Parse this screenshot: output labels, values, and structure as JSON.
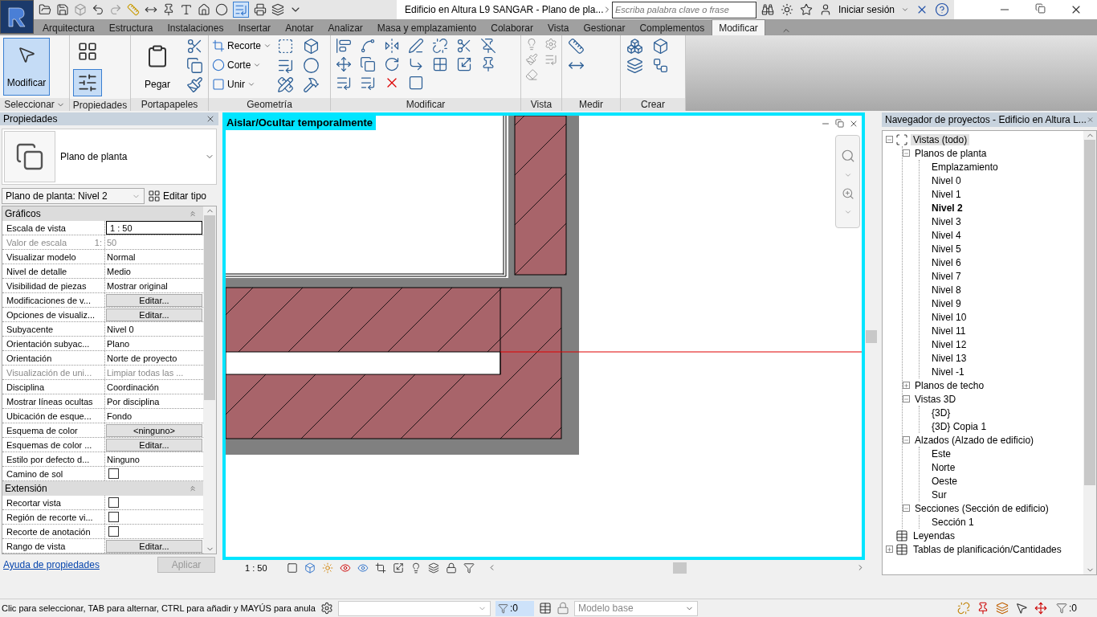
{
  "title_bar": {
    "title": "Edificio en Altura L9 SANGAR - Plano de pla...",
    "search": {
      "placeholder": "Escriba palabra clave o frase"
    },
    "sign_in": "Iniciar sesión"
  },
  "ribbon_tabs": [
    {
      "label": "Arquitectura",
      "selected": false
    },
    {
      "label": "Estructura",
      "selected": false
    },
    {
      "label": "Instalaciones",
      "selected": false
    },
    {
      "label": "Insertar",
      "selected": false
    },
    {
      "label": "Anotar",
      "selected": false
    },
    {
      "label": "Analizar",
      "selected": false
    },
    {
      "label": "Masa y emplazamiento",
      "selected": false
    },
    {
      "label": "Colaborar",
      "selected": false
    },
    {
      "label": "Vista",
      "selected": false
    },
    {
      "label": "Gestionar",
      "selected": false
    },
    {
      "label": "Complementos",
      "selected": false
    },
    {
      "label": "Modificar",
      "selected": true
    }
  ],
  "ribbon_panels": [
    {
      "label": "Seleccionar",
      "has_menu": true,
      "tools": [
        {
          "kind": "large",
          "label": "Modificar",
          "selected": true
        }
      ]
    },
    {
      "label": "Propiedades",
      "has_menu": false,
      "tools": [
        {
          "kind": "icon",
          "selected": false
        },
        {
          "kind": "icon",
          "selected": true
        }
      ]
    },
    {
      "label": "Portapapeles",
      "has_menu": false,
      "tools": [
        {
          "kind": "large",
          "label": "Pegar",
          "selected": false
        }
      ]
    },
    {
      "label": "Geometría",
      "has_menu": false,
      "tools": [
        {
          "kind": "small",
          "label": "Recorte",
          "selected": false
        },
        {
          "kind": "small",
          "label": "Corte",
          "selected": false
        },
        {
          "kind": "small",
          "label": "Unir",
          "selected": false
        }
      ]
    },
    {
      "label": "Modificar",
      "has_menu": false
    },
    {
      "label": "Vista",
      "has_menu": false
    },
    {
      "label": "Medir",
      "has_menu": false
    },
    {
      "label": "Crear",
      "has_menu": false
    }
  ],
  "properties": {
    "title": "Propiedades",
    "type_name": "Plano de planta",
    "instance": "Plano de planta: Nivel 2",
    "edit_type": "Editar tipo",
    "sections": [
      {
        "title": "Gráficos",
        "rows": [
          {
            "kind": "field",
            "label": "Escala de vista",
            "value": "1 : 50",
            "disabled": false
          },
          {
            "kind": "text",
            "label": "Valor de escala",
            "unit": "1:",
            "value": "50",
            "disabled": true
          },
          {
            "kind": "text",
            "label": "Visualizar modelo",
            "value": "Normal",
            "disabled": false
          },
          {
            "kind": "text",
            "label": "Nivel de detalle",
            "value": "Medio",
            "disabled": false
          },
          {
            "kind": "text",
            "label": "Visibilidad de piezas",
            "value": "Mostrar original",
            "disabled": false
          },
          {
            "kind": "button",
            "label": "Modificaciones de v...",
            "value": "Editar...",
            "disabled": false
          },
          {
            "kind": "button",
            "label": "Opciones de visualiz...",
            "value": "Editar...",
            "disabled": false
          },
          {
            "kind": "text",
            "label": "Subyacente",
            "value": "Nivel 0",
            "disabled": false
          },
          {
            "kind": "text",
            "label": "Orientación subyac...",
            "value": "Plano",
            "disabled": false
          },
          {
            "kind": "text",
            "label": "Orientación",
            "value": "Norte de proyecto",
            "disabled": false
          },
          {
            "kind": "text",
            "label": "Visualización de uni...",
            "value": "Limpiar todas las ...",
            "disabled": true
          },
          {
            "kind": "text",
            "label": "Disciplina",
            "value": "Coordinación",
            "disabled": false
          },
          {
            "kind": "text",
            "label": "Mostrar líneas ocultas",
            "value": "Por disciplina",
            "disabled": false
          },
          {
            "kind": "text",
            "label": "Ubicación de esque...",
            "value": "Fondo",
            "disabled": false
          },
          {
            "kind": "button",
            "label": "Esquema de color",
            "value": "<ninguno>",
            "disabled": false
          },
          {
            "kind": "button",
            "label": "Esquemas de color ...",
            "value": "Editar...",
            "disabled": false
          },
          {
            "kind": "text",
            "label": "Estilo por defecto d...",
            "value": "Ninguno",
            "disabled": false
          },
          {
            "kind": "checkbox",
            "label": "Camino de sol",
            "checked": false,
            "disabled": false
          }
        ]
      },
      {
        "title": "Extensión",
        "rows": [
          {
            "kind": "checkbox",
            "label": "Recortar vista",
            "checked": false,
            "disabled": false
          },
          {
            "kind": "checkbox",
            "label": "Región de recorte vi...",
            "checked": false,
            "disabled": false
          },
          {
            "kind": "checkbox",
            "label": "Recorte de anotación",
            "checked": false,
            "disabled": false
          },
          {
            "kind": "button",
            "label": "Rango de vista",
            "value": "Editar...",
            "disabled": false
          }
        ]
      }
    ],
    "help_link": "Ayuda de propiedades",
    "apply": {
      "label": "Aplicar",
      "disabled": true
    }
  },
  "view": {
    "banner": "Aislar/Ocultar temporalmente",
    "scale": "1 : 50"
  },
  "project_browser": {
    "title": "Navegador de proyectos - Edificio en Altura L...",
    "tree": [
      {
        "label": "Vistas (todo)",
        "expanded": true,
        "selected": true,
        "current": false,
        "children": [
          {
            "label": "Planos de planta",
            "expanded": true,
            "selected": false,
            "current": false,
            "children": [
              {
                "label": "Emplazamiento",
                "selected": false,
                "current": false
              },
              {
                "label": "Nivel 0",
                "selected": false,
                "current": false
              },
              {
                "label": "Nivel 1",
                "selected": false,
                "current": false
              },
              {
                "label": "Nivel 2",
                "selected": false,
                "current": true
              },
              {
                "label": "Nivel 3",
                "selected": false,
                "current": false
              },
              {
                "label": "Nivel 4",
                "selected": false,
                "current": false
              },
              {
                "label": "Nivel 5",
                "selected": false,
                "current": false
              },
              {
                "label": "Nivel 6",
                "selected": false,
                "current": false
              },
              {
                "label": "Nivel 7",
                "selected": false,
                "current": false
              },
              {
                "label": "Nivel 8",
                "selected": false,
                "current": false
              },
              {
                "label": "Nivel 9",
                "selected": false,
                "current": false
              },
              {
                "label": "Nivel 10",
                "selected": false,
                "current": false
              },
              {
                "label": "Nivel 11",
                "selected": false,
                "current": false
              },
              {
                "label": "Nivel 12",
                "selected": false,
                "current": false
              },
              {
                "label": "Nivel 13",
                "selected": false,
                "current": false
              },
              {
                "label": "Nivel -1",
                "selected": false,
                "current": false
              }
            ]
          },
          {
            "label": "Planos de techo",
            "expanded": false,
            "selected": false,
            "current": false
          },
          {
            "label": "Vistas 3D",
            "expanded": true,
            "selected": false,
            "current": false,
            "children": [
              {
                "label": "{3D}",
                "selected": false,
                "current": false
              },
              {
                "label": "{3D} Copia 1",
                "selected": false,
                "current": false
              }
            ]
          },
          {
            "label": "Alzados (Alzado de edificio)",
            "expanded": true,
            "selected": false,
            "current": false,
            "children": [
              {
                "label": "Este",
                "selected": false,
                "current": false
              },
              {
                "label": "Norte",
                "selected": false,
                "current": false
              },
              {
                "label": "Oeste",
                "selected": false,
                "current": false
              },
              {
                "label": "Sur",
                "selected": false,
                "current": false
              }
            ]
          },
          {
            "label": "Secciones (Sección de edificio)",
            "expanded": true,
            "selected": false,
            "current": false,
            "children": [
              {
                "label": "Sección 1",
                "selected": false,
                "current": false
              }
            ]
          }
        ]
      },
      {
        "label": "Leyendas",
        "selected": false,
        "current": false
      },
      {
        "label": "Tablas de planificación/Cantidades",
        "expanded": false,
        "selected": false,
        "current": false
      }
    ]
  },
  "status_bar": {
    "message": "Clic para seleccionar, TAB para alternar, CTRL para añadir y MAYÚS para anula",
    "filter_count": ":0",
    "workset": {
      "value": "Modelo base",
      "disabled": true
    },
    "selection_count": ":0"
  }
}
